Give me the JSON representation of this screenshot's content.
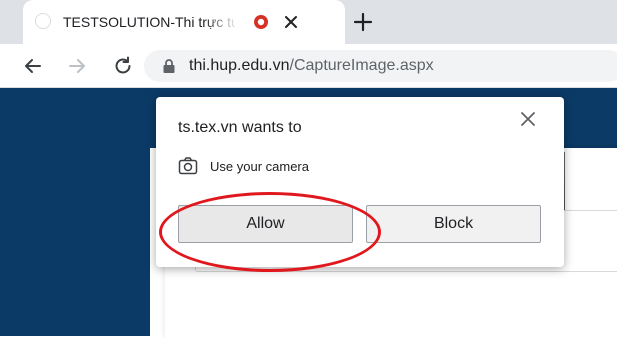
{
  "browser": {
    "tab": {
      "title": "TESTSOLUTION-Thi trực tuyế",
      "favicon_icon": "blank-favicon-icon",
      "recording_icon": "record-dot-icon",
      "close_icon": "close-icon"
    },
    "new_tab_icon": "plus-icon",
    "toolbar": {
      "back_icon": "arrow-left-icon",
      "forward_icon": "arrow-right-icon",
      "reload_icon": "reload-icon",
      "lock_icon": "lock-icon",
      "url_host": "thi.hup.edu.vn",
      "url_path": "/CaptureImage.aspx"
    }
  },
  "permission_dialog": {
    "title": "ts.tex.vn wants to",
    "request_icon": "camera-icon",
    "request_text": "Use your camera",
    "allow_label": "Allow",
    "block_label": "Block"
  },
  "colors": {
    "page_header": "#0b3a66",
    "annotation": "#e0181e",
    "recording": "#d93025"
  }
}
